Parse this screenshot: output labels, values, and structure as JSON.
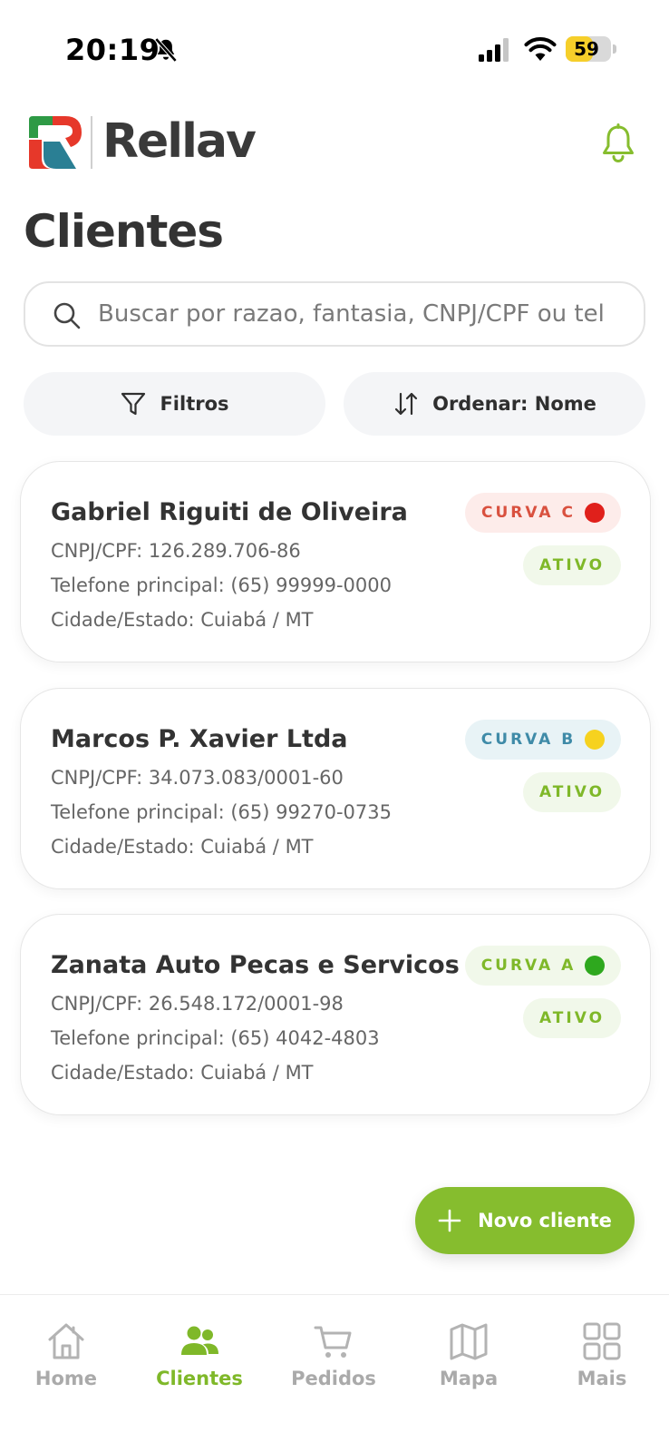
{
  "status_bar": {
    "time": "20:19",
    "battery": "59",
    "battery_level_percent": 59
  },
  "header": {
    "brand": "Rellav",
    "title": "Clientes"
  },
  "search": {
    "placeholder": "Buscar por razao, fantasia, CNPJ/CPF ou tel"
  },
  "toolbar": {
    "filters_label": "Filtros",
    "sort_label": "Ordenar: Nome"
  },
  "clients": [
    {
      "name": "Gabriel Riguiti de Oliveira",
      "doc": "CNPJ/CPF: 126.289.706-86",
      "phone": "Telefone principal: (65) 99999-0000",
      "city": "Cidade/Estado: Cuiabá / MT",
      "curve": "CURVA C",
      "status": "ATIVO"
    },
    {
      "name": "Marcos P. Xavier Ltda",
      "doc": "CNPJ/CPF: 34.073.083/0001-60",
      "phone": "Telefone principal: (65) 99270-0735",
      "city": "Cidade/Estado: Cuiabá / MT",
      "curve": "CURVA B",
      "status": "ATIVO"
    },
    {
      "name": "Zanata Auto Pecas e Servicos",
      "doc": "CNPJ/CPF: 26.548.172/0001-98",
      "phone": "Telefone principal: (65) 4042-4803",
      "city": "Cidade/Estado: Cuiabá / MT",
      "curve": "CURVA A",
      "status": "ATIVO"
    }
  ],
  "fab": {
    "label": "Novo cliente"
  },
  "nav": [
    {
      "label": "Home",
      "icon": "home-icon"
    },
    {
      "label": "Clientes",
      "icon": "users-icon",
      "active": true
    },
    {
      "label": "Pedidos",
      "icon": "cart-icon"
    },
    {
      "label": "Mapa",
      "icon": "map-icon"
    },
    {
      "label": "Mais",
      "icon": "grid-icon"
    }
  ],
  "colors": {
    "accent": "#86bd2e",
    "curve_c": "#d9513f",
    "curve_b": "#3f8ba8",
    "curve_a": "#7fb829",
    "dot_red": "#e0201b",
    "dot_yellow": "#f6d21f",
    "dot_green": "#2ea81e"
  }
}
